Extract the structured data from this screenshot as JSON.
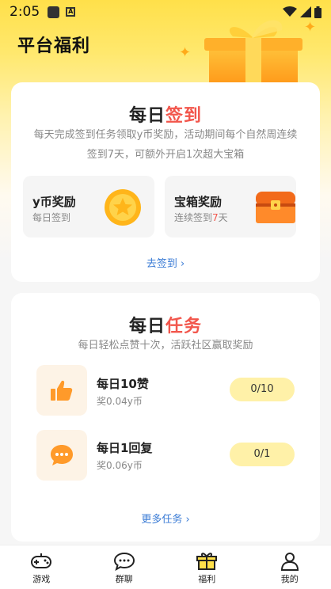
{
  "status_bar": {
    "time": "2:05",
    "badge_letter": "A"
  },
  "page_title": "平台福利",
  "checkin": {
    "heading_black": "每日",
    "heading_red": "签到",
    "desc_line1": "每天完成签到任务领取y币奖励，活动期间每个自然周连续",
    "desc_line2": "签到7天，可额外开启1次超大宝箱",
    "rewards": [
      {
        "title": "y币奖励",
        "sub": "每日签到",
        "icon": "coin-icon"
      },
      {
        "title": "宝箱奖励",
        "sub_prefix": "连续签到",
        "sub_highlight": "7",
        "sub_suffix": "天",
        "icon": "treasure-chest-icon"
      }
    ],
    "link": "去签到"
  },
  "tasks": {
    "heading_black": "每日",
    "heading_red": "任务",
    "desc": "每日轻松点赞十次，活跃社区赢取奖励",
    "items": [
      {
        "title": "每日10赞",
        "reward": "奖0.04y币",
        "progress": "0/10",
        "icon": "thumbs-up-icon"
      },
      {
        "title": "每日1回复",
        "reward": "奖0.06y币",
        "progress": "0/1",
        "icon": "chat-bubble-icon"
      }
    ],
    "link": "更多任务"
  },
  "bottom_nav": [
    {
      "label": "游戏",
      "icon": "gamepad-icon"
    },
    {
      "label": "群聊",
      "icon": "chat-icon"
    },
    {
      "label": "福利",
      "icon": "gift-icon",
      "active": true
    },
    {
      "label": "我的",
      "icon": "user-icon"
    }
  ],
  "colors": {
    "accent_red": "#f2564c",
    "link_blue": "#3a7bd5",
    "brand_yellow": "#ffe04a"
  }
}
